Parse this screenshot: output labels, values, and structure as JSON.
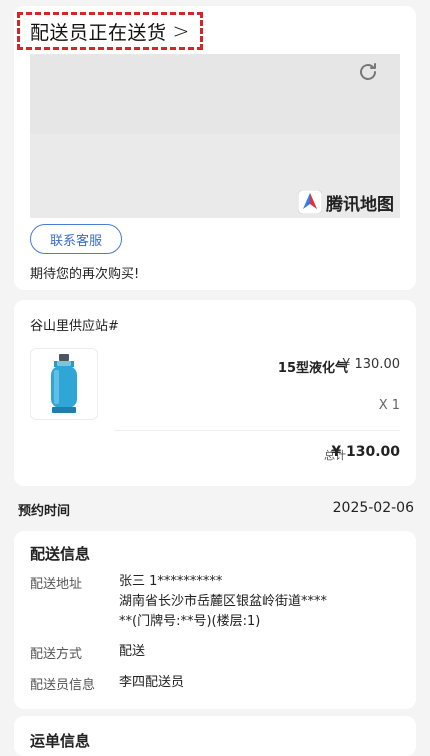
{
  "status": {
    "title": "配送员正在送货",
    "chevron": ">"
  },
  "map": {
    "brand_label": "腾讯地图",
    "refresh_icon": "refresh-icon",
    "logo_icon": "tencent-map-logo-icon"
  },
  "actions": {
    "contact_label": "联系客服"
  },
  "messages": {
    "thanks": "期待您的再次购买!"
  },
  "order": {
    "store_name": "谷山里供应站#",
    "product": {
      "name": "15型液化气",
      "price": "¥ 130.00",
      "quantity": "X 1",
      "image_icon": "gas-cylinder-icon"
    },
    "total_label": "总计",
    "total_value": "¥ 130.00"
  },
  "reservation": {
    "label": "预约时间",
    "value": "2025-02-06"
  },
  "delivery": {
    "title": "配送信息",
    "address_label": "配送地址",
    "address_line1": "张三 1**********",
    "address_line2": "湖南省长沙市岳麓区银盆岭街道****",
    "address_line3": "**(门牌号:**号)(楼层:1)",
    "method_label": "配送方式",
    "method_value": "配送",
    "courier_label": "配送员信息",
    "courier_value": "李四配送员"
  },
  "next_section": {
    "title": "运单信息"
  },
  "colors": {
    "highlight_border": "#d8232a",
    "accent_blue": "#3b6cc9",
    "page_bg": "#f4f4f4"
  }
}
